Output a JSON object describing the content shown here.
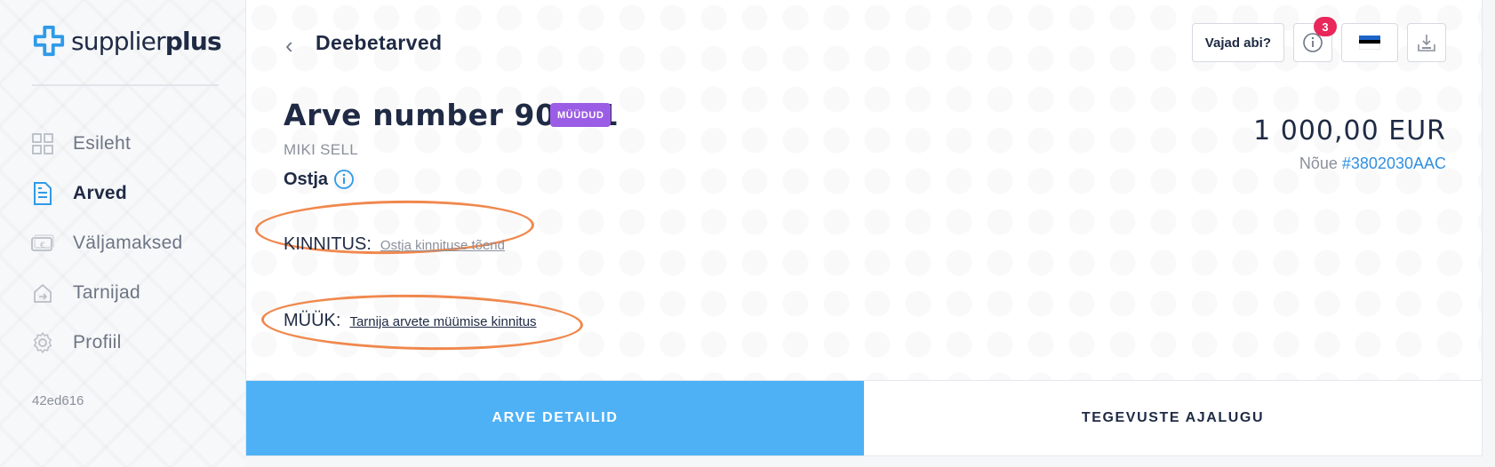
{
  "brand": {
    "name_regular": "supplier",
    "name_bold": "plus",
    "accent": "#2f9be8"
  },
  "sidebar": {
    "items": [
      {
        "label": "Esileht",
        "icon": "dashboard-icon",
        "active": false
      },
      {
        "label": "Arved",
        "icon": "document-icon",
        "active": true
      },
      {
        "label": "Väljamaksed",
        "icon": "payment-icon",
        "active": false
      },
      {
        "label": "Tarnijad",
        "icon": "suppliers-icon",
        "active": false
      },
      {
        "label": "Profiil",
        "icon": "gear-icon",
        "active": false
      }
    ],
    "version": "42ed616"
  },
  "header": {
    "back_glyph": "‹",
    "title": "Deebetarved",
    "help_label": "Vajad abi?",
    "notification_count": "3",
    "language_flag": "Estonia"
  },
  "invoice": {
    "title": "Arve number 90771",
    "status": "MÜÜDUD",
    "seller": "MIKI SELL",
    "buyer_label": "Ostja",
    "amount": "1 000,00 EUR",
    "claim_label": "Nõue",
    "claim_id": "#3802030AAC",
    "confirmation_label": "KINNITUS:",
    "confirmation_link": "Ostja kinnituse tõend",
    "sale_label": "MÜÜK:",
    "sale_link": "Tarnija arvete müümise kinnitus"
  },
  "tabs": [
    {
      "label": "ARVE DETAILID",
      "active": true
    },
    {
      "label": "TEGEVUSTE AJALUGU",
      "active": false
    }
  ],
  "colors": {
    "primary_tab": "#4fb1f5",
    "status_badge": "#9b5de5",
    "highlight": "#f0884d",
    "notification": "#e8275a",
    "link": "#2f8fe0"
  }
}
